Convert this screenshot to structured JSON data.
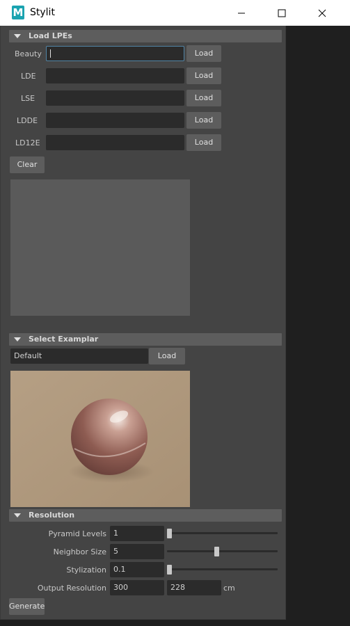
{
  "window": {
    "title": "Stylit",
    "icon_letter": "M"
  },
  "titlebar_buttons": {
    "minimize": "minimize",
    "maximize": "maximize",
    "close": "close"
  },
  "load_lpes": {
    "header": "Load LPEs",
    "rows": [
      {
        "label": "Beauty",
        "value": "",
        "button": "Load"
      },
      {
        "label": "LDE",
        "value": "",
        "button": "Load"
      },
      {
        "label": "LSE",
        "value": "",
        "button": "Load"
      },
      {
        "label": "LDDE",
        "value": "",
        "button": "Load"
      },
      {
        "label": "LD12E",
        "value": "",
        "button": "Load"
      }
    ],
    "clear_button": "Clear"
  },
  "select_examplar": {
    "header": "Select Examplar",
    "value": "Default",
    "button": "Load"
  },
  "resolution": {
    "header": "Resolution",
    "pyramid_levels": {
      "label": "Pyramid Levels",
      "value": "1",
      "slider_fraction": 0.0
    },
    "neighbor_size": {
      "label": "Neighbor Size",
      "value": "5",
      "slider_fraction": 0.45
    },
    "stylization": {
      "label": "Stylization",
      "value": "0.1",
      "slider_fraction": 0.0
    },
    "output_resolution": {
      "label": "Output Resolution",
      "width": "300",
      "height": "228",
      "unit": "cm"
    }
  },
  "generate_button": "Generate",
  "colors": {
    "accent": "#5285a6",
    "panel": "#444444",
    "header": "#5d5d5d"
  }
}
